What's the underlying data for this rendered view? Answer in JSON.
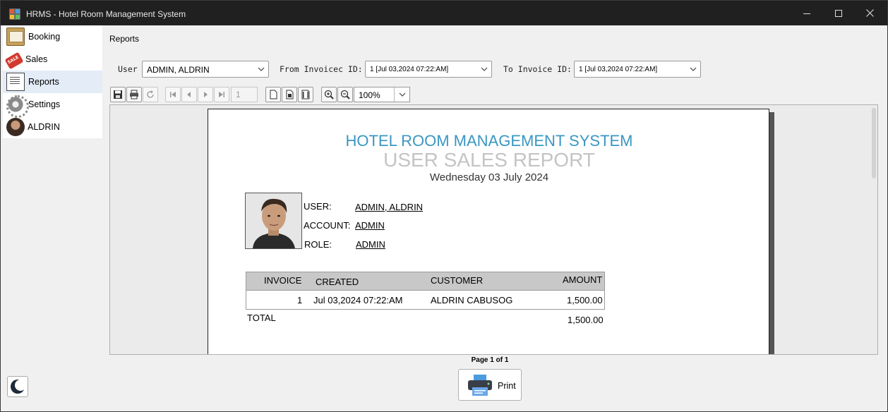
{
  "window": {
    "title": "HRMS - Hotel Room Management System"
  },
  "sidebar": {
    "items": [
      {
        "label": "Booking",
        "icon": "book-icon"
      },
      {
        "label": "Sales",
        "icon": "sale-tag-icon"
      },
      {
        "label": "Reports",
        "icon": "report-icon",
        "active": true
      },
      {
        "label": "Settings",
        "icon": "gear-icon"
      },
      {
        "label": "ALDRIN",
        "icon": "user-avatar-icon"
      }
    ],
    "theme_toggle_icon": "moon-icon"
  },
  "main": {
    "section_title": "Reports",
    "filters": {
      "user_label": "User",
      "user_value": "ADMIN, ALDRIN",
      "from_label": "From Invoicec ID:",
      "from_value": "1   [Jul 03,2024 07:22:AM]",
      "to_label": "To Invoice ID:",
      "to_value": "1   [Jul 03,2024 07:22:AM]"
    },
    "toolbar": {
      "page_number": "1",
      "zoom": "100%"
    }
  },
  "report": {
    "hotel_name": "HOTEL ROOM MANAGEMENT SYSTEM",
    "title": "USER SALES REPORT",
    "date": "Wednesday 03 July 2024",
    "user_label": "USER:",
    "user_value": "ADMIN, ALDRIN",
    "account_label": "ACCOUNT:",
    "account_value": "ADMIN",
    "role_label": "ROLE:",
    "role_value": "ADMIN",
    "table": {
      "headers": {
        "invoice": "INVOICE",
        "created": "CREATED",
        "customer": "CUSTOMER",
        "amount": "AMOUNT"
      },
      "rows": [
        {
          "invoice": "1",
          "created": "Jul 03,2024 07:22:AM",
          "customer": "ALDRIN CABUSOG",
          "amount": "1,500.00"
        }
      ],
      "total_label": "TOTAL",
      "total_value": "1,500.00"
    }
  },
  "footer": {
    "page_indicator": "Page 1 of 1",
    "print_label": "Print"
  },
  "colors": {
    "accent_title": "#3a97c2",
    "report_subtitle": "#c4c4c4",
    "titlebar": "#202020"
  }
}
